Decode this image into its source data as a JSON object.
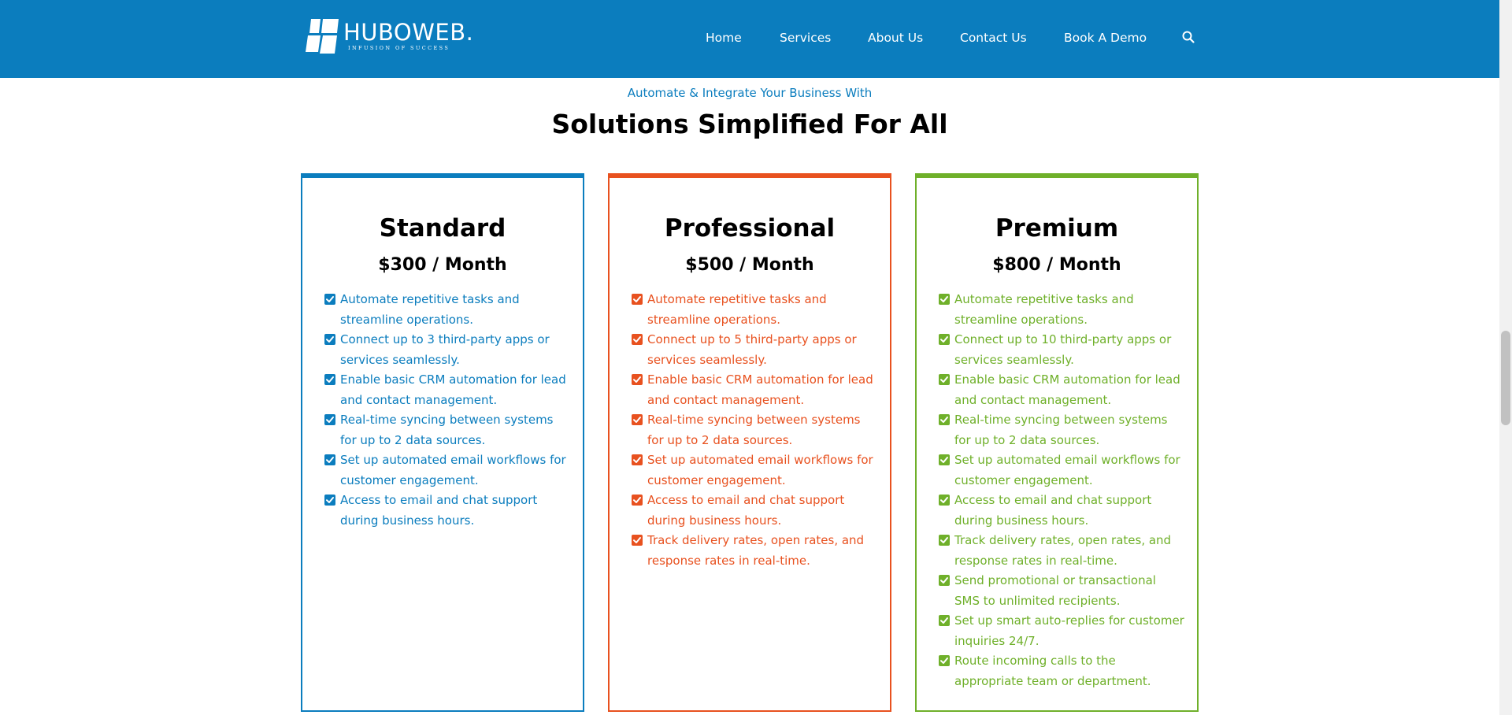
{
  "header": {
    "logo": {
      "word": "HUBOWEB.",
      "tagline": "INFUSION OF SUCCESS"
    },
    "nav": [
      {
        "label": "Home",
        "name": "nav-home"
      },
      {
        "label": "Services",
        "name": "nav-services"
      },
      {
        "label": "About Us",
        "name": "nav-about-us"
      },
      {
        "label": "Contact Us",
        "name": "nav-contact-us"
      },
      {
        "label": "Book A Demo",
        "name": "nav-book-a-demo"
      }
    ],
    "search_icon": "search-icon",
    "background": "#0b7dbe"
  },
  "intro": {
    "subtitle": "Automate & Integrate Your Business With",
    "headline": "Solutions Simplified For All"
  },
  "plans": [
    {
      "name": "Standard",
      "price": "$300 / Month",
      "color": "#0b7dbe",
      "features": [
        "Automate repetitive tasks and streamline operations.",
        "Connect up to 3 third-party apps or services seamlessly.",
        "Enable basic CRM automation for lead and contact management.",
        "Real-time syncing between systems for up to 2 data sources.",
        "Set up automated email workflows for customer engagement.",
        "Access to email and chat support during business hours."
      ]
    },
    {
      "name": "Professional",
      "price": "$500 / Month",
      "color": "#e8511f",
      "features": [
        "Automate repetitive tasks and streamline operations.",
        "Connect up to 5 third-party apps or services seamlessly.",
        "Enable basic CRM automation for lead and contact management.",
        "Real-time syncing between systems for up to 2 data sources.",
        "Set up automated email workflows for customer engagement.",
        "Access to email and chat support during business hours.",
        "Track delivery rates, open rates, and response rates in real-time."
      ]
    },
    {
      "name": "Premium",
      "price": "$800 / Month",
      "color": "#6fb02a",
      "features": [
        "Automate repetitive tasks and streamline operations.",
        "Connect up to 10 third-party apps or services seamlessly.",
        "Enable basic CRM automation for lead and contact management.",
        "Real-time syncing between systems for up to 2 data sources.",
        "Set up automated email workflows for customer engagement.",
        "Access to email and chat support during business hours.",
        "Track delivery rates, open rates, and response rates in real-time.",
        "Send promotional or transactional SMS to unlimited recipients.",
        "Set up smart auto-replies for customer inquiries 24/7.",
        "Route incoming calls to the appropriate team or department."
      ]
    }
  ]
}
